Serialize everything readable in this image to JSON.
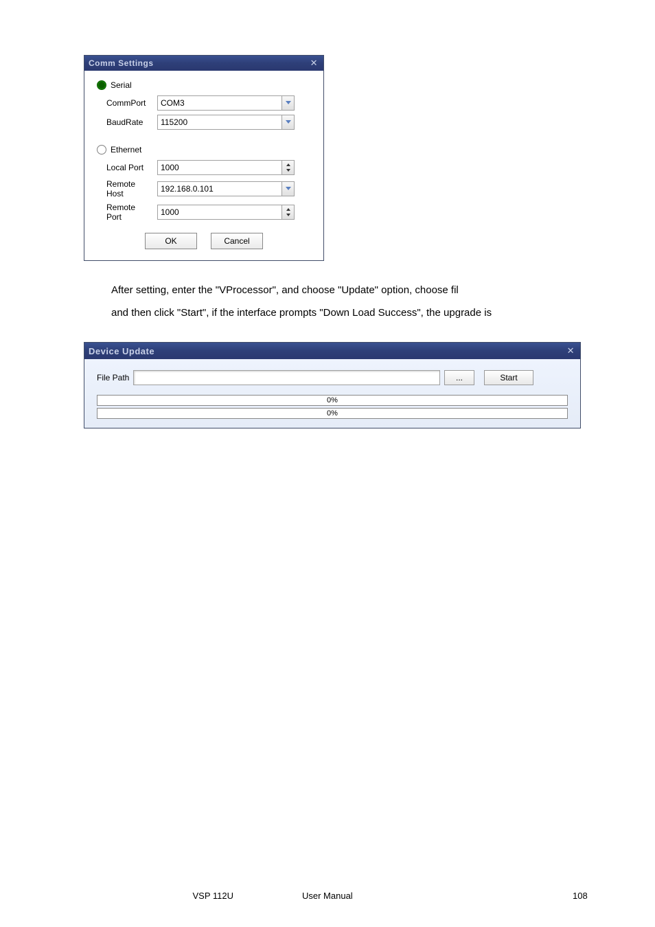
{
  "commSettings": {
    "title": "Comm Settings",
    "serialLabel": "Serial",
    "commPortLabel": "CommPort",
    "commPortValue": "COM3",
    "baudRateLabel": "BaudRate",
    "baudRateValue": "115200",
    "ethernetLabel": "Ethernet",
    "localPortLabel": "Local Port",
    "localPortValue": "1000",
    "remoteHostLabel": "Remote Host",
    "remoteHostValue": "192.168.0.101",
    "remotePortLabel": "Remote Port",
    "remotePortValue": "1000",
    "okLabel": "OK",
    "cancelLabel": "Cancel"
  },
  "instructions": {
    "line1": "After setting, enter the \"VProcessor\", and choose \"Update\" option, choose fil",
    "line2": "and then click \"Start\", if the interface prompts \"Down Load Success\", the upgrade is"
  },
  "deviceUpdate": {
    "title": "Device Update",
    "filePathLabel": "File Path",
    "browseLabel": "...",
    "startLabel": "Start",
    "progress1": "0%",
    "progress2": "0%"
  },
  "footer": {
    "model": "VSP 112U",
    "docType": "User Manual",
    "page": "108"
  }
}
